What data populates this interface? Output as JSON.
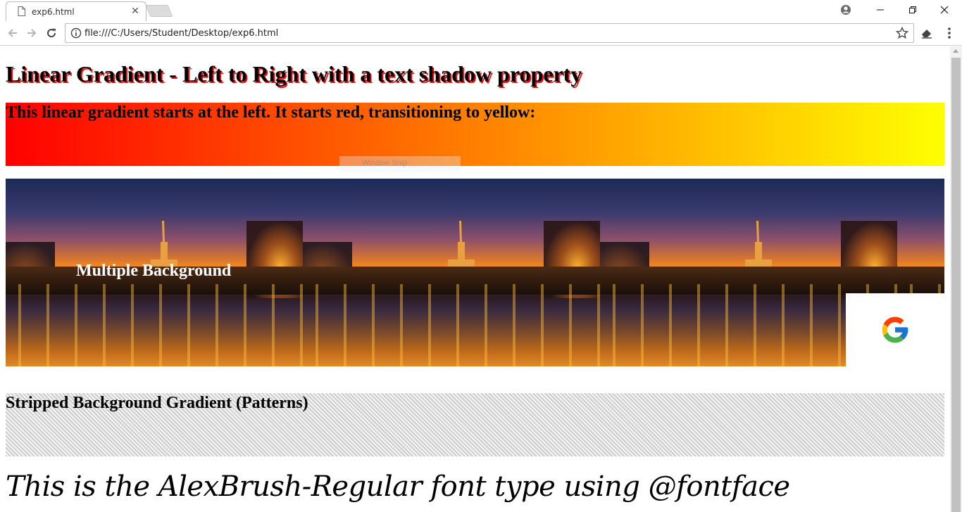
{
  "browser": {
    "tab_title": "exp6.html",
    "url": "file:///C:/Users/Student/Desktop/exp6.html"
  },
  "page": {
    "heading": "Linear Gradient - Left to Right with a text shadow property",
    "gradient_text": "This linear gradient starts at the left. It starts red, transitioning to yellow:",
    "gradient_colors": [
      "#ff0000",
      "#ffff00"
    ],
    "heading_shadow_color": "#ff0000",
    "overlay_text": "Window Snip",
    "multiple_background_label": "Multiple Background",
    "stripe_text": "Stripped Background Gradient (Patterns)",
    "font_demo_text": "This is the AlexBrush-Regular font type using @fontface"
  }
}
